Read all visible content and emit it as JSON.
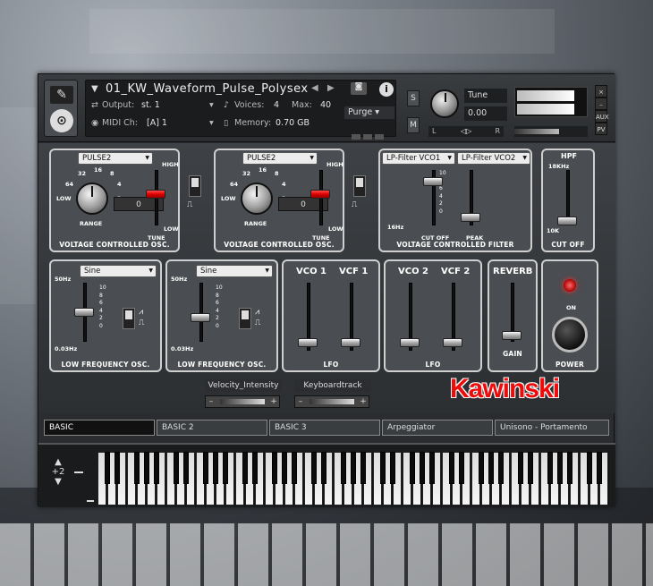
{
  "header": {
    "instrument_name": "01_KW_Waveform_Pulse_Polysex",
    "output_label": "Output:",
    "output_value": "st. 1",
    "voices_label": "Voices:",
    "voices_value": "4",
    "max_label": "Max:",
    "max_value": "40",
    "purge_label": "Purge",
    "midi_label": "MIDI Ch:",
    "midi_value": "[A]  1",
    "memory_label": "Memory:",
    "memory_value": "0.70 GB",
    "solo": "S",
    "mute": "M",
    "tune_label": "Tune",
    "tune_value": "0.00",
    "pan_left": "L",
    "pan_right": "R",
    "aux": "AUX",
    "pv": "PV",
    "close": "×",
    "minimize": "–"
  },
  "vco1": {
    "waveform": "PULSE2",
    "range_label": "RANGE",
    "tune_label": "TUNE",
    "tune_value": "0",
    "title": "VOLTAGE CONTROLLED OSC.",
    "range_ticks": [
      "32",
      "16",
      "8",
      "4",
      "2",
      "64",
      "LOW"
    ],
    "high": "HIGH",
    "low": "LOW"
  },
  "vco2": {
    "waveform": "PULSE2",
    "range_label": "RANGE",
    "tune_label": "TUNE",
    "tune_value": "0",
    "title": "VOLTAGE CONTROLLED OSC.",
    "range_ticks": [
      "32",
      "16",
      "8",
      "4",
      "2",
      "64",
      "LOW"
    ],
    "high": "HIGH",
    "low": "LOW"
  },
  "vcf": {
    "filter1": "LP-Filter VCO1",
    "filter2": "LP-Filter VCO2",
    "cutoff_label": "CUT OFF",
    "peak_label": "PEAK",
    "title": "VOLTAGE CONTROLLED FILTER",
    "freq_low": "16Hz",
    "scale": [
      "10",
      "8",
      "6",
      "4",
      "2",
      "0"
    ]
  },
  "hpf": {
    "title": "HPF",
    "cutoff_label": "CUT OFF",
    "freq_high": "18KHz",
    "freq_low": "10K"
  },
  "lfo1": {
    "waveform": "Sine",
    "freq_high": "50Hz",
    "freq_low": "0.03Hz",
    "title": "LOW FREQUENCY OSC.",
    "scale": [
      "10",
      "8",
      "6",
      "4",
      "2",
      "0"
    ]
  },
  "lfo2": {
    "waveform": "Sine",
    "freq_high": "50Hz",
    "freq_low": "0.03Hz",
    "title": "LOW FREQUENCY OSC.",
    "scale": [
      "10",
      "8",
      "6",
      "4",
      "2",
      "0"
    ]
  },
  "lfo_mod1": {
    "col1": "VCO 1",
    "col2": "VCF 1",
    "title": "LFO"
  },
  "lfo_mod2": {
    "col1": "VCO 2",
    "col2": "VCF 2",
    "title": "LFO"
  },
  "reverb": {
    "title": "REVERB",
    "gain_label": "GAIN"
  },
  "power": {
    "on_label": "ON",
    "title": "POWER"
  },
  "controls": {
    "velocity": "Velocity_Intensity",
    "keytrack": "Keyboardtrack"
  },
  "brand": "Kawinski",
  "tabs": [
    "BASIC",
    "BASIC 2",
    "BASIC 3",
    "Arpeggiator",
    "Unisono - Portamento"
  ],
  "keyboard": {
    "octave": "+2"
  }
}
